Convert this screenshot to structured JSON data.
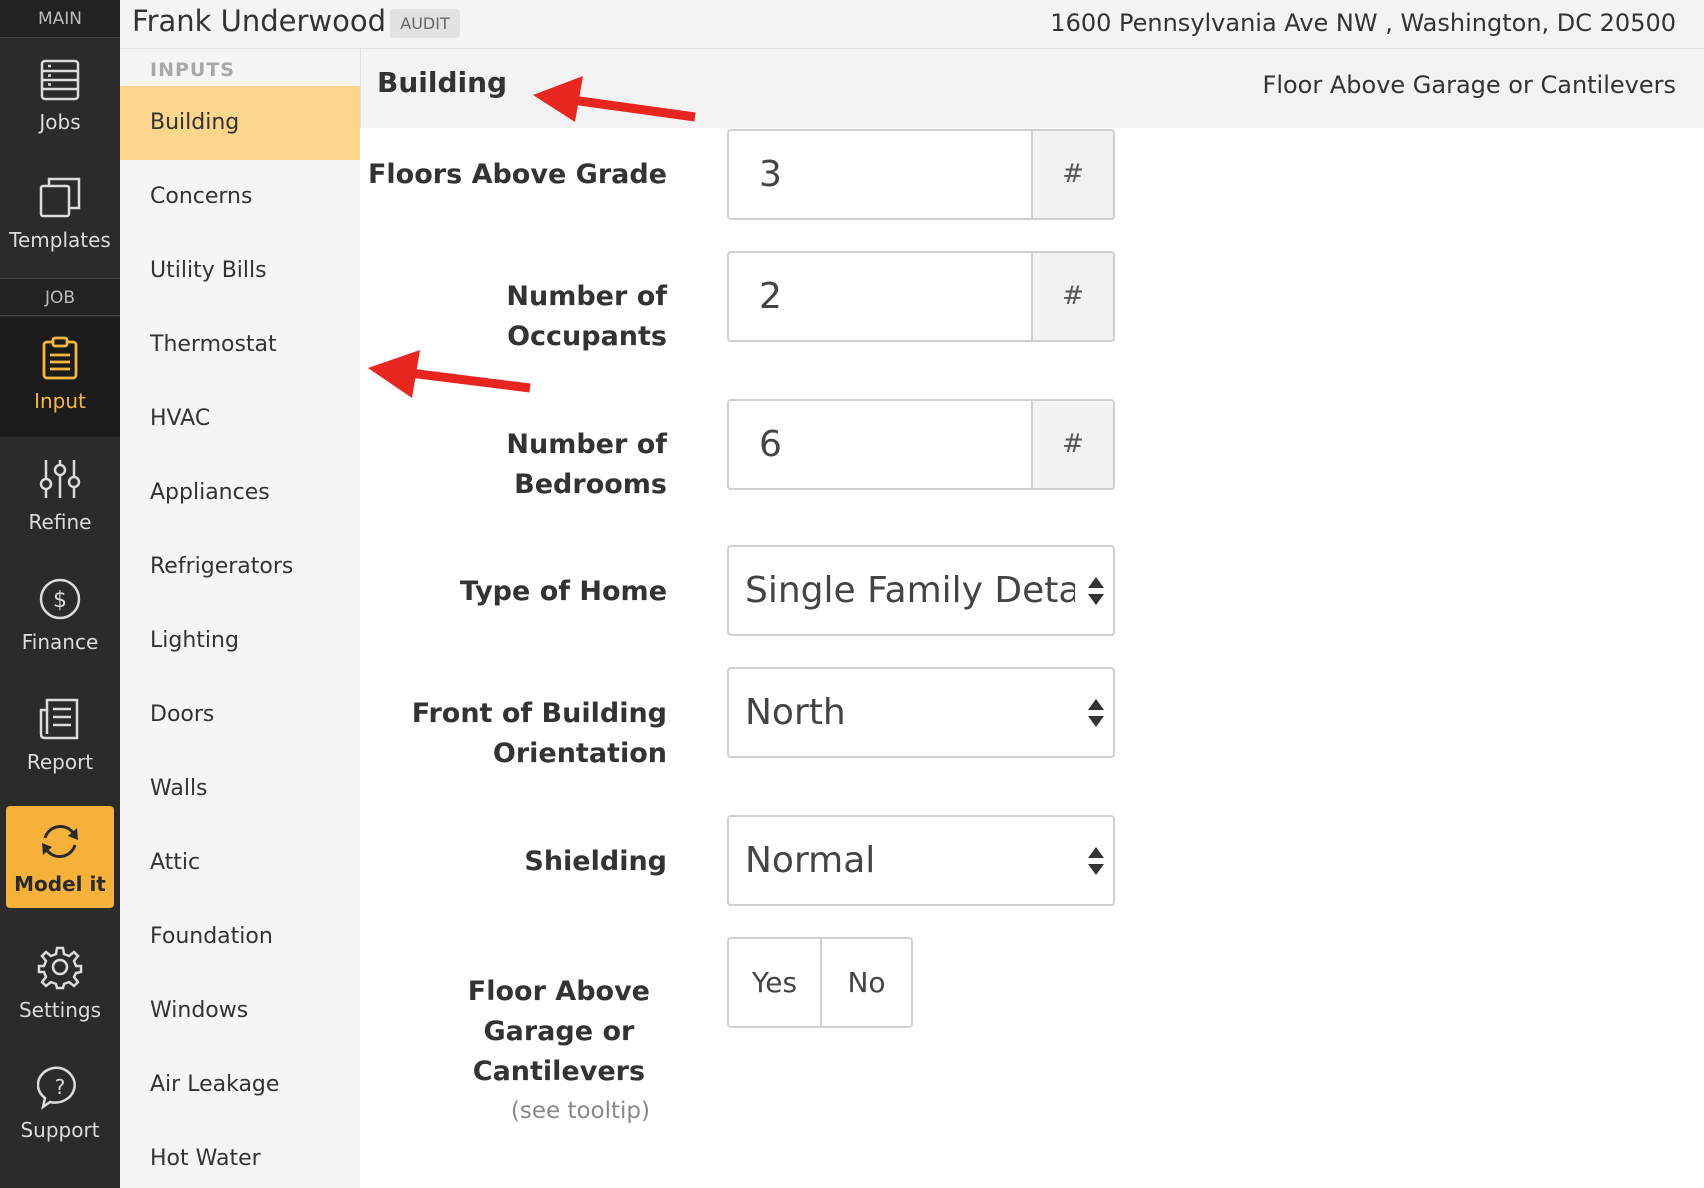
{
  "sidebar": {
    "main_label": "MAIN",
    "job_label": "JOB",
    "items": [
      {
        "label": "Jobs",
        "icon": "list-icon"
      },
      {
        "label": "Templates",
        "icon": "copy-icon"
      },
      {
        "label": "Input",
        "icon": "clipboard-icon"
      },
      {
        "label": "Refine",
        "icon": "sliders-icon"
      },
      {
        "label": "Finance",
        "icon": "dollar-icon"
      },
      {
        "label": "Report",
        "icon": "document-icon"
      },
      {
        "label": "Model it",
        "icon": "refresh-icon"
      },
      {
        "label": "Settings",
        "icon": "gear-icon"
      },
      {
        "label": "Support",
        "icon": "help-icon"
      }
    ],
    "active": "Input"
  },
  "header": {
    "user_name": "Frank Underwood",
    "badge": "AUDIT",
    "address": "1600 Pennsylvania Ave NW , Washington, DC 20500"
  },
  "subnav": {
    "title": "INPUTS",
    "items": [
      "Building",
      "Concerns",
      "Utility Bills",
      "Thermostat",
      "HVAC",
      "Appliances",
      "Refrigerators",
      "Lighting",
      "Doors",
      "Walls",
      "Attic",
      "Foundation",
      "Windows",
      "Air Leakage",
      "Hot Water"
    ],
    "active": "Building"
  },
  "section": {
    "title": "Building",
    "hint": "Floor Above Garage or Cantilevers"
  },
  "form": {
    "floors_above_grade": {
      "label": "Floors Above Grade",
      "value": "3",
      "addon": "#"
    },
    "occupants": {
      "label_line1": "Number of",
      "label_line2": "Occupants",
      "value": "2",
      "addon": "#"
    },
    "bedrooms": {
      "label_line1": "Number of",
      "label_line2": "Bedrooms",
      "value": "6",
      "addon": "#"
    },
    "type_of_home": {
      "label": "Type of Home",
      "value": "Single Family Detached"
    },
    "orientation": {
      "label_line1": "Front of Building",
      "label_line2": "Orientation",
      "value": "North"
    },
    "shielding": {
      "label": "Shielding",
      "value": "Normal"
    },
    "floor_above_garage": {
      "label_line1": "Floor Above",
      "label_line2": "Garage or",
      "label_line3": "Cantilevers",
      "note": "(see tooltip)",
      "yes": "Yes",
      "no": "No"
    }
  },
  "colors": {
    "accent": "#f6b13b",
    "active_sub": "#fbd68c",
    "sidebar_bg": "#2b2b2b",
    "arrow": "#e8261f"
  }
}
